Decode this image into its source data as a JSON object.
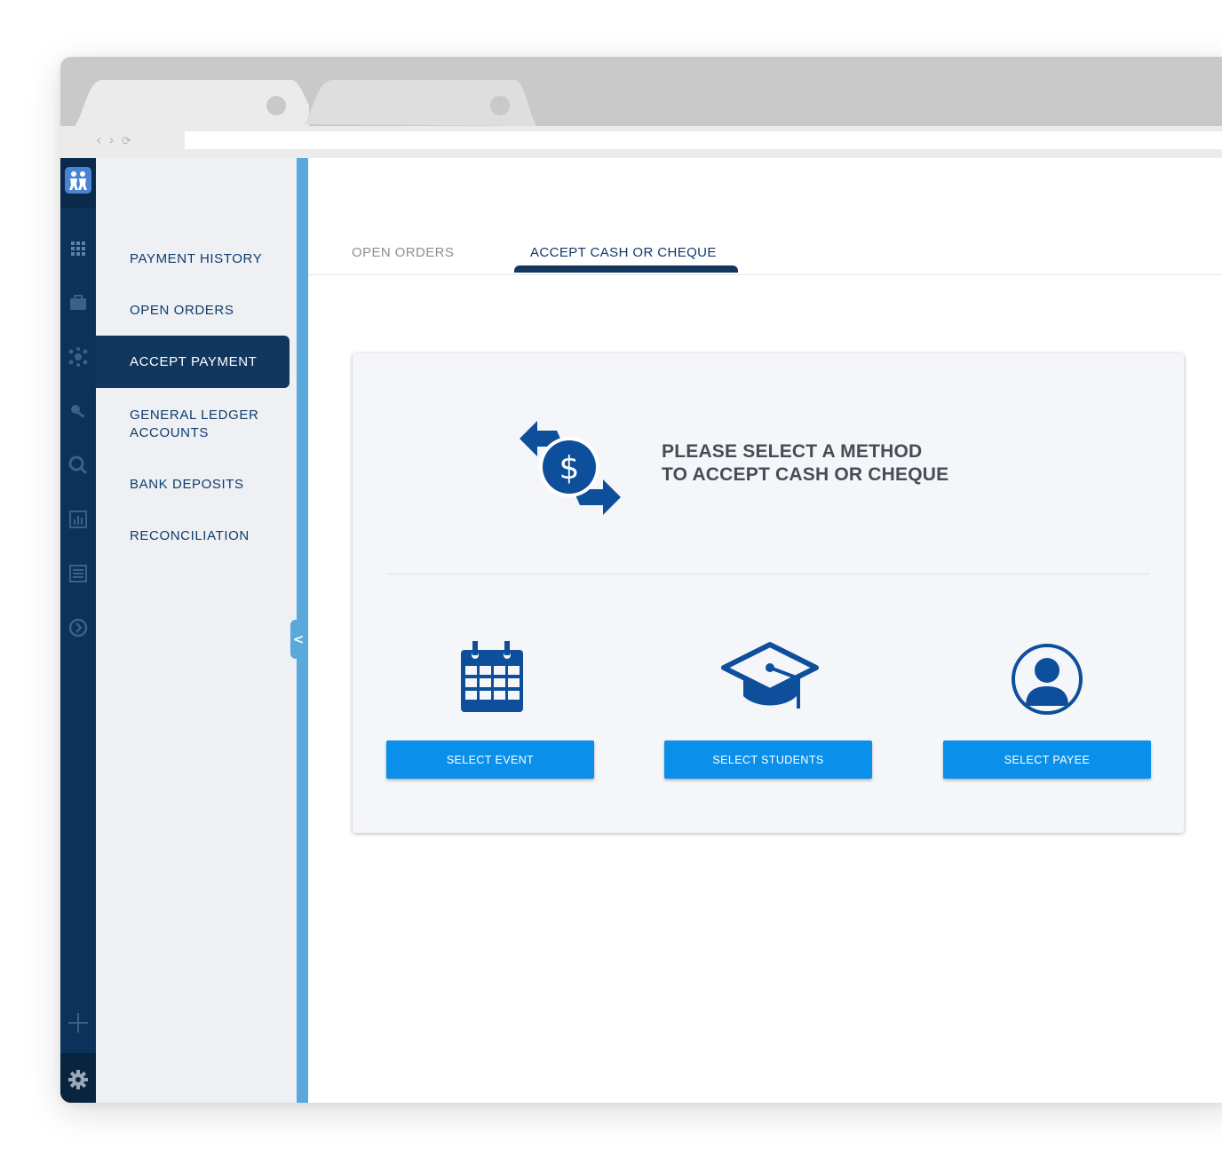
{
  "browser": {
    "nav_back": "‹",
    "nav_forward": "›",
    "nav_reload": "⟳"
  },
  "rail": {
    "icons": [
      "people-logo-icon",
      "grid-icon",
      "briefcase-icon",
      "network-icon",
      "key-icon",
      "magnifier-icon",
      "bar-chart-icon",
      "list-icon",
      "arrow-circle-icon",
      "plus-icon",
      "gear-icon"
    ]
  },
  "subnav": {
    "items": [
      {
        "label": "PAYMENT HISTORY"
      },
      {
        "label": "OPEN ORDERS"
      },
      {
        "label": "ACCEPT PAYMENT",
        "active": true
      },
      {
        "label": "GENERAL LEDGER",
        "label2": "ACCOUNTS"
      },
      {
        "label": "BANK DEPOSITS"
      },
      {
        "label": "RECONCILIATION"
      }
    ],
    "collapse_glyph": "<"
  },
  "tabs": [
    {
      "label": "OPEN ORDERS",
      "active": false
    },
    {
      "label": "ACCEPT CASH OR CHEQUE",
      "active": true
    }
  ],
  "card": {
    "heading_line1": "PLEASE SELECT A METHOD",
    "heading_line2": "TO ACCEPT CASH OR CHEQUE",
    "hero_icon": "dollar-exchange-icon",
    "options": [
      {
        "icon": "calendar-icon",
        "button": "SELECT EVENT"
      },
      {
        "icon": "graduation-cap-icon",
        "button": "SELECT STUDENTS"
      },
      {
        "icon": "user-circle-icon",
        "button": "SELECT PAYEE"
      }
    ]
  },
  "colors": {
    "rail": "#0d3259",
    "subnav_bg": "#eef0f3",
    "active_item": "#11375f",
    "accent_bar": "#5aa8dc",
    "button": "#0a90ea",
    "icon_blue": "#0e4f9c"
  }
}
